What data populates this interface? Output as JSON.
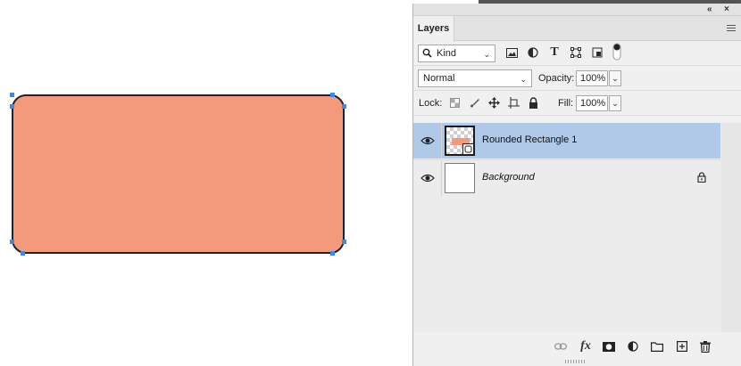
{
  "canvas": {
    "shape_fill": "#f29a7b",
    "shape_stroke": "#1d2330",
    "handle_color": "#3d8be0"
  },
  "panel": {
    "top_buttons": [
      "collapse-icon",
      "close-icon"
    ],
    "tab_label": "Layers",
    "menu_icon": "hamburger-icon",
    "filter": {
      "kind_label": "Kind",
      "icons": [
        "image-filter-icon",
        "adjustment-filter-icon",
        "type-filter-icon",
        "shape-filter-icon",
        "smart-object-filter-icon",
        "filter-toggle-icon"
      ]
    },
    "blend": {
      "mode": "Normal",
      "opacity_label": "Opacity:",
      "opacity_value": "100%"
    },
    "lock": {
      "label": "Lock:",
      "icons": [
        "lock-transparent-icon",
        "lock-image-icon",
        "lock-position-icon",
        "lock-artboard-icon",
        "lock-all-icon"
      ],
      "fill_label": "Fill:",
      "fill_value": "100%"
    },
    "layers": [
      {
        "name": "Rounded Rectangle 1",
        "selected": true,
        "visible": true,
        "italic": false,
        "locked": false
      },
      {
        "name": "Background",
        "selected": false,
        "visible": true,
        "italic": true,
        "locked": true
      }
    ],
    "selection_color": "#b1c9e8",
    "bottom_icons": [
      "link-layers-icon",
      "fx-icon",
      "add-mask-icon",
      "adjustment-layer-icon",
      "new-group-icon",
      "new-layer-icon",
      "delete-icon"
    ],
    "fx_label": "fx"
  }
}
